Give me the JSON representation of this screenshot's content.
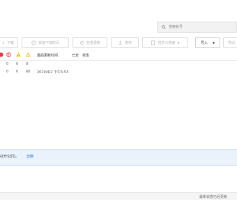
{
  "search": {
    "placeholder": "搜索帐号"
  },
  "toolbar": {
    "download_label": "下载",
    "install_label": "安装下载时间",
    "check_update_label": "检查更新",
    "publish_label": "发布",
    "custom_filter_label": "自定义搜索",
    "import_label": "导入",
    "export_label": "导出"
  },
  "table": {
    "header_updated": "最后更新时间",
    "header_installed": "已安",
    "header_status": "状态",
    "summary_counts": [
      "0",
      "0",
      "0"
    ],
    "row": {
      "c1": "0",
      "c2": "0",
      "c3": "60",
      "updated": "2019/4/2 下午5:53"
    }
  },
  "notice": {
    "text": "打开它们)。",
    "link": "忽略"
  },
  "statusbar": {
    "text": "最新状态已经更新"
  }
}
